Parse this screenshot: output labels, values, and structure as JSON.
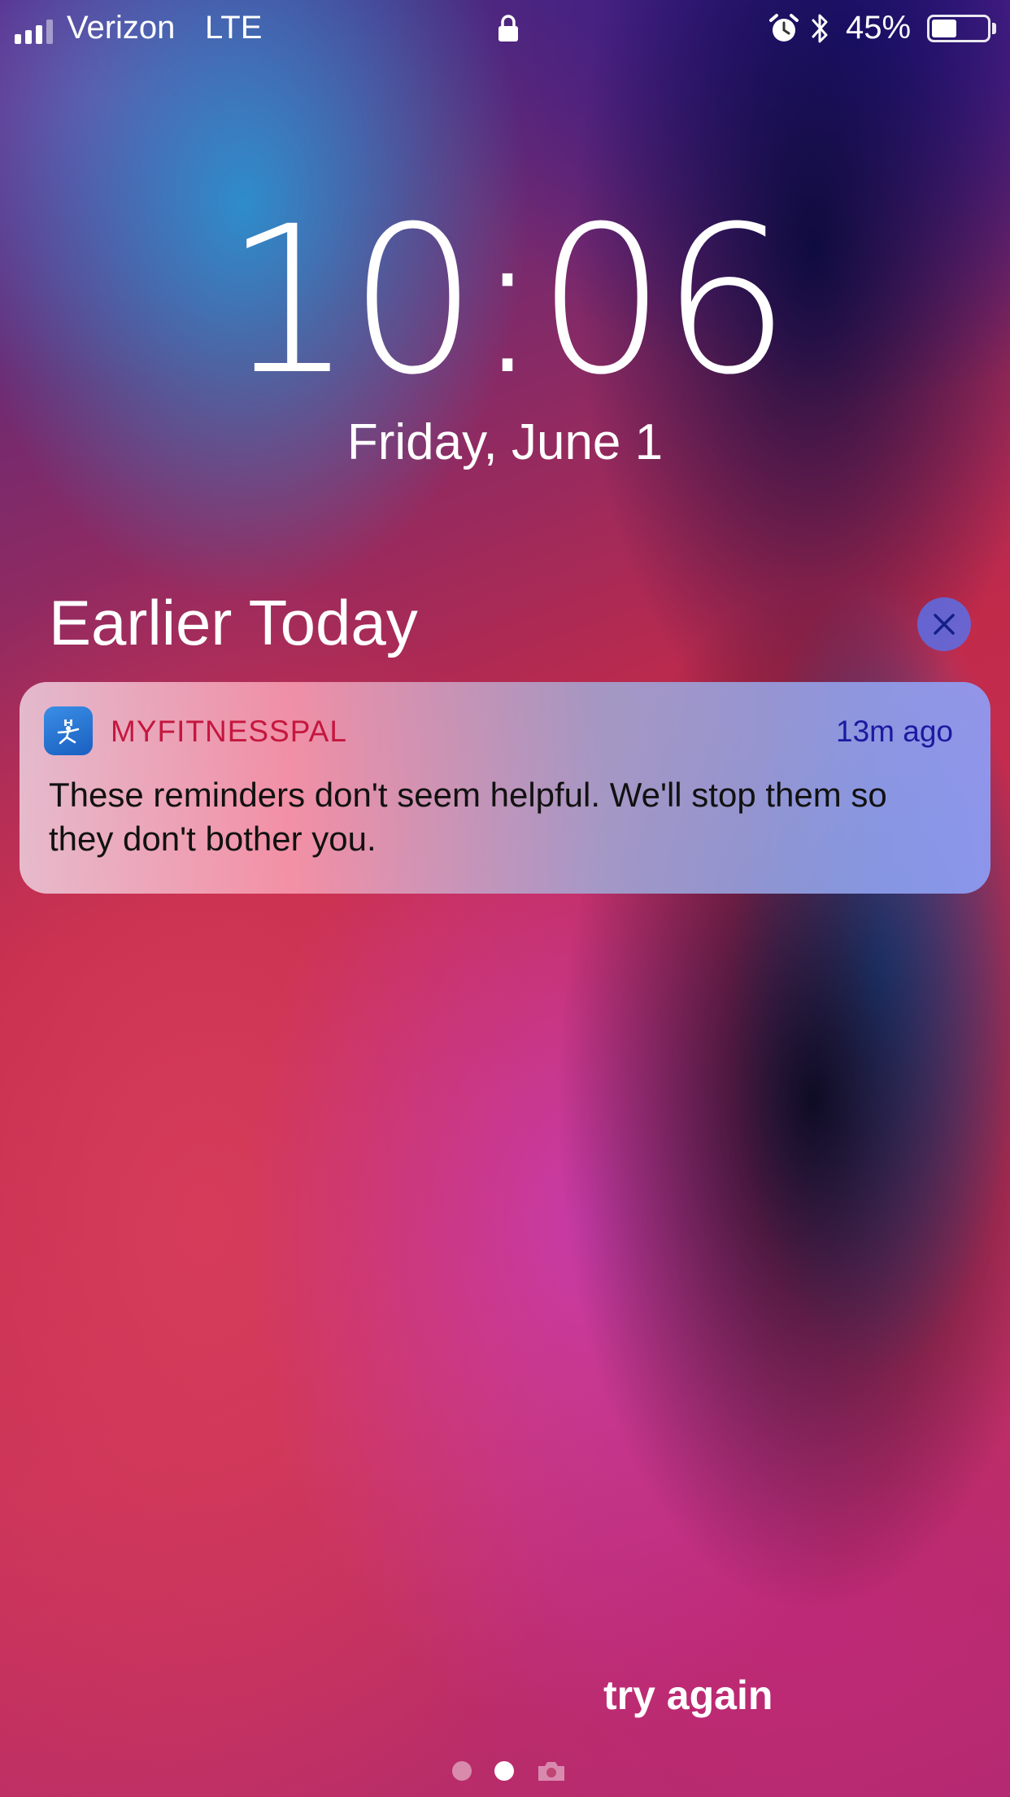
{
  "status_bar": {
    "carrier": "Verizon",
    "network": "LTE",
    "battery_percent_text": "45%",
    "battery_level": 0.45,
    "signal_bars_filled": 3,
    "signal_bars_total": 4,
    "icons": [
      "signal-icon",
      "lock-icon",
      "alarm-icon",
      "bluetooth-icon",
      "battery-icon"
    ]
  },
  "lock_screen": {
    "time": "10:06",
    "date": "Friday, June 1"
  },
  "notifications": {
    "section_title": "Earlier Today",
    "clear_icon": "close-icon",
    "items": [
      {
        "app_name": "MYFITNESSPAL",
        "app_icon": "myfitnesspal-app-icon",
        "time": "13m ago",
        "body": "These reminders don't seem helpful. We'll stop them so they don't bother you."
      }
    ]
  },
  "caption": "try again",
  "page_indicator": {
    "pages": 2,
    "active": 1,
    "extra_icon": "camera-icon"
  },
  "colors": {
    "app_name": "#c4173f",
    "notif_time": "#1a1aa0",
    "clear_button": "#5a6ee6"
  }
}
